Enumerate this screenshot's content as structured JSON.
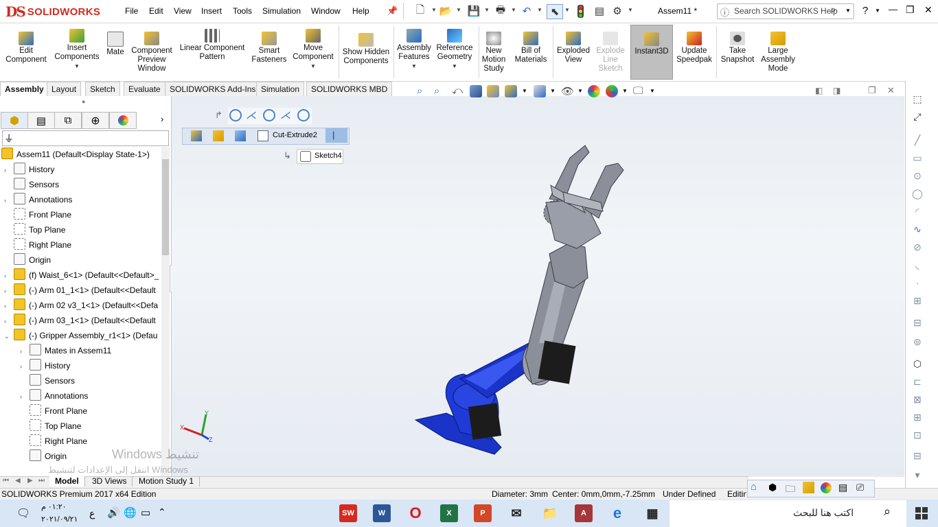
{
  "app": {
    "logo_prefix": "DS",
    "logo_text": "SOLIDWORKS",
    "document_title": "Assem11 *",
    "help_search_placeholder": "Search SOLIDWORKS Help"
  },
  "menu": [
    "File",
    "Edit",
    "View",
    "Insert",
    "Tools",
    "Simulation",
    "Window",
    "Help"
  ],
  "window_controls": {
    "help": "?",
    "minimize": "—",
    "restore": "❐",
    "close": "✕"
  },
  "commands": [
    {
      "label": "Edit Component",
      "icon": "edit-component-icon"
    },
    {
      "label": "Insert Components",
      "icon": "insert-components-icon"
    },
    {
      "label": "Mate",
      "icon": "mate-icon"
    },
    {
      "label": "Component Preview Window",
      "icon": "component-preview-icon"
    },
    {
      "label": "Linear Component Pattern",
      "icon": "linear-pattern-icon"
    },
    {
      "label": "Smart Fasteners",
      "icon": "smart-fasteners-icon"
    },
    {
      "label": "Move Component",
      "icon": "move-component-icon"
    },
    {
      "label": "Show Hidden Components",
      "icon": "show-hidden-icon"
    },
    {
      "label": "Assembly Features",
      "icon": "assembly-features-icon"
    },
    {
      "label": "Reference Geometry",
      "icon": "reference-geometry-icon"
    },
    {
      "label": "New Motion Study",
      "icon": "motion-study-icon"
    },
    {
      "label": "Bill of Materials",
      "icon": "bom-icon"
    },
    {
      "label": "Exploded View",
      "icon": "exploded-view-icon"
    },
    {
      "label": "Explode Line Sketch",
      "icon": "explode-line-icon"
    },
    {
      "label": "Instant3D",
      "icon": "instant3d-icon"
    },
    {
      "label": "Update Speedpak",
      "icon": "speedpak-icon"
    },
    {
      "label": "Take Snapshot",
      "icon": "snapshot-icon"
    },
    {
      "label": "Large Assembly Mode",
      "icon": "large-assembly-icon"
    }
  ],
  "tabs": [
    "Assembly",
    "Layout",
    "Sketch",
    "Evaluate",
    "SOLIDWORKS Add-Ins",
    "Simulation",
    "SOLIDWORKS MBD"
  ],
  "breadcrumb": {
    "feature": "Cut-Extrude2",
    "sketch": "Sketch4"
  },
  "tree": {
    "root": "Assem11  (Default<Display State-1>)",
    "items": [
      {
        "label": "History",
        "type": "folder",
        "expand": "›"
      },
      {
        "label": "Sensors",
        "type": "folder",
        "expand": ""
      },
      {
        "label": "Annotations",
        "type": "folder",
        "expand": "›"
      },
      {
        "label": "Front Plane",
        "type": "plane",
        "expand": ""
      },
      {
        "label": "Top Plane",
        "type": "plane",
        "expand": ""
      },
      {
        "label": "Right Plane",
        "type": "plane",
        "expand": ""
      },
      {
        "label": "Origin",
        "type": "origin",
        "expand": ""
      },
      {
        "label": "(f) Waist_6<1> (Default<<Default>_",
        "type": "part",
        "expand": "›"
      },
      {
        "label": "(-) Arm 01_1<1> (Default<<Default",
        "type": "part",
        "expand": "›"
      },
      {
        "label": "(-) Arm 02 v3_1<1> (Default<<Defa",
        "type": "part",
        "expand": "›"
      },
      {
        "label": "(-) Arm 03_1<1> (Default<<Default",
        "type": "part",
        "expand": "›"
      },
      {
        "label": "(-) Gripper Assembly_r1<1> (Defau",
        "type": "part",
        "expand": "⌄"
      }
    ],
    "sub_items": [
      {
        "label": "Mates in Assem11",
        "type": "folder",
        "expand": "›"
      },
      {
        "label": "History",
        "type": "folder",
        "expand": "›"
      },
      {
        "label": "Sensors",
        "type": "folder",
        "expand": ""
      },
      {
        "label": "Annotations",
        "type": "folder",
        "expand": "›"
      },
      {
        "label": "Front Plane",
        "type": "plane",
        "expand": ""
      },
      {
        "label": "Top Plane",
        "type": "plane",
        "expand": ""
      },
      {
        "label": "Right Plane",
        "type": "plane",
        "expand": ""
      },
      {
        "label": "Origin",
        "type": "origin",
        "expand": ""
      }
    ]
  },
  "triad": {
    "x": "X",
    "y": "Y",
    "z": "Z"
  },
  "bottom_tabs": [
    "Model",
    "3D Views",
    "Motion Study 1"
  ],
  "status": {
    "edition": "SOLIDWORKS Premium 2017 x64 Edition",
    "diameter": "Diameter: 3mm",
    "center": "Center: 0mm,0mm,-7.25mm",
    "state": "Under Defined",
    "mode": "Editing"
  },
  "watermark": {
    "line1": "Windows تنشيط",
    "line2": "انتقل إلى الإعدادات لتنشيط Windows"
  },
  "taskbar": {
    "time": "٠١:٢٠ م",
    "date": "٢٠٢١/٠٩/٢١",
    "lang": "ع",
    "search_placeholder": "اكتب هنا للبحث",
    "apps": [
      "SW",
      "W",
      "O",
      "X",
      "P",
      "✉",
      "📁",
      "A",
      "e",
      "▦"
    ]
  },
  "colors": {
    "solidworks_red": "#d42a1f",
    "arm_blue": "#1a33c8",
    "gripper_gray": "#8a8f99",
    "accent": "#2d6bc5"
  }
}
